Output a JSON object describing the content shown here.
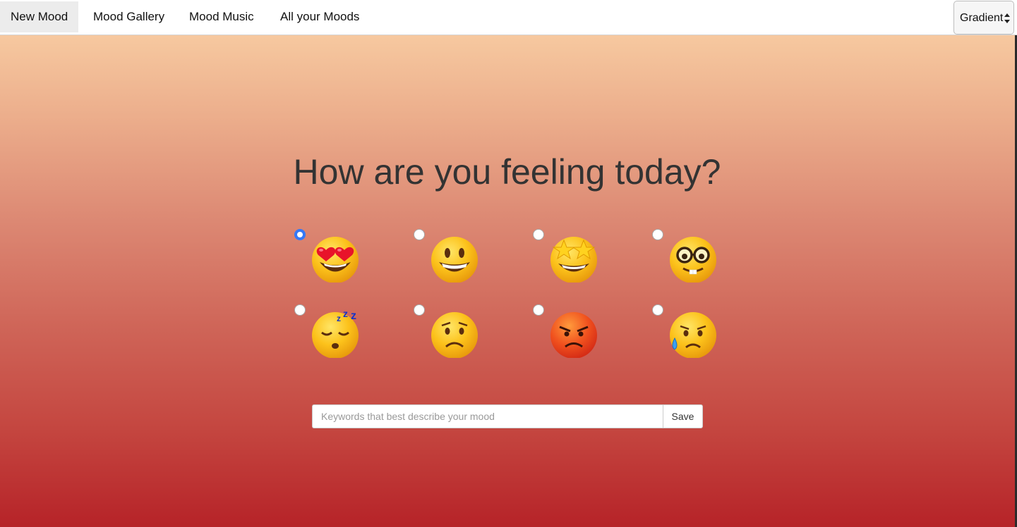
{
  "nav": {
    "items": [
      {
        "label": "New Mood",
        "active": true
      },
      {
        "label": "Mood Gallery",
        "active": false
      },
      {
        "label": "Mood Music",
        "active": false
      },
      {
        "label": "All your Moods",
        "active": false
      }
    ],
    "theme_select": {
      "selected": "Gradient"
    }
  },
  "main": {
    "heading": "How are you feeling today?",
    "moods": [
      {
        "icon": "heart-eyes-face-icon",
        "selected": true
      },
      {
        "icon": "grinning-face-icon",
        "selected": false
      },
      {
        "icon": "star-struck-face-icon",
        "selected": false
      },
      {
        "icon": "nerd-face-icon",
        "selected": false
      },
      {
        "icon": "sleeping-face-icon",
        "selected": false
      },
      {
        "icon": "worried-face-icon",
        "selected": false
      },
      {
        "icon": "angry-face-icon",
        "selected": false
      },
      {
        "icon": "sad-sweat-face-icon",
        "selected": false
      }
    ],
    "keywords": {
      "placeholder": "Keywords that best describe your mood",
      "value": ""
    },
    "save_label": "Save"
  },
  "colors": {
    "gradient_top": "#fbd4a8",
    "gradient_bottom": "#b62328",
    "radio_checked": "#3478f6",
    "heading_text": "#333333"
  }
}
